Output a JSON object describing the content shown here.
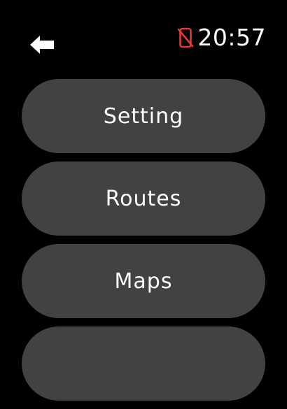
{
  "status": {
    "time": "20:57",
    "back_icon": "back-arrow-icon",
    "phone_icon": "phone-disconnected-icon",
    "alert_color": "#e03a3a"
  },
  "menu": {
    "button_color": "#424242",
    "items": [
      {
        "label": "Setting"
      },
      {
        "label": "Routes"
      },
      {
        "label": "Maps"
      },
      {
        "label": ""
      }
    ]
  }
}
